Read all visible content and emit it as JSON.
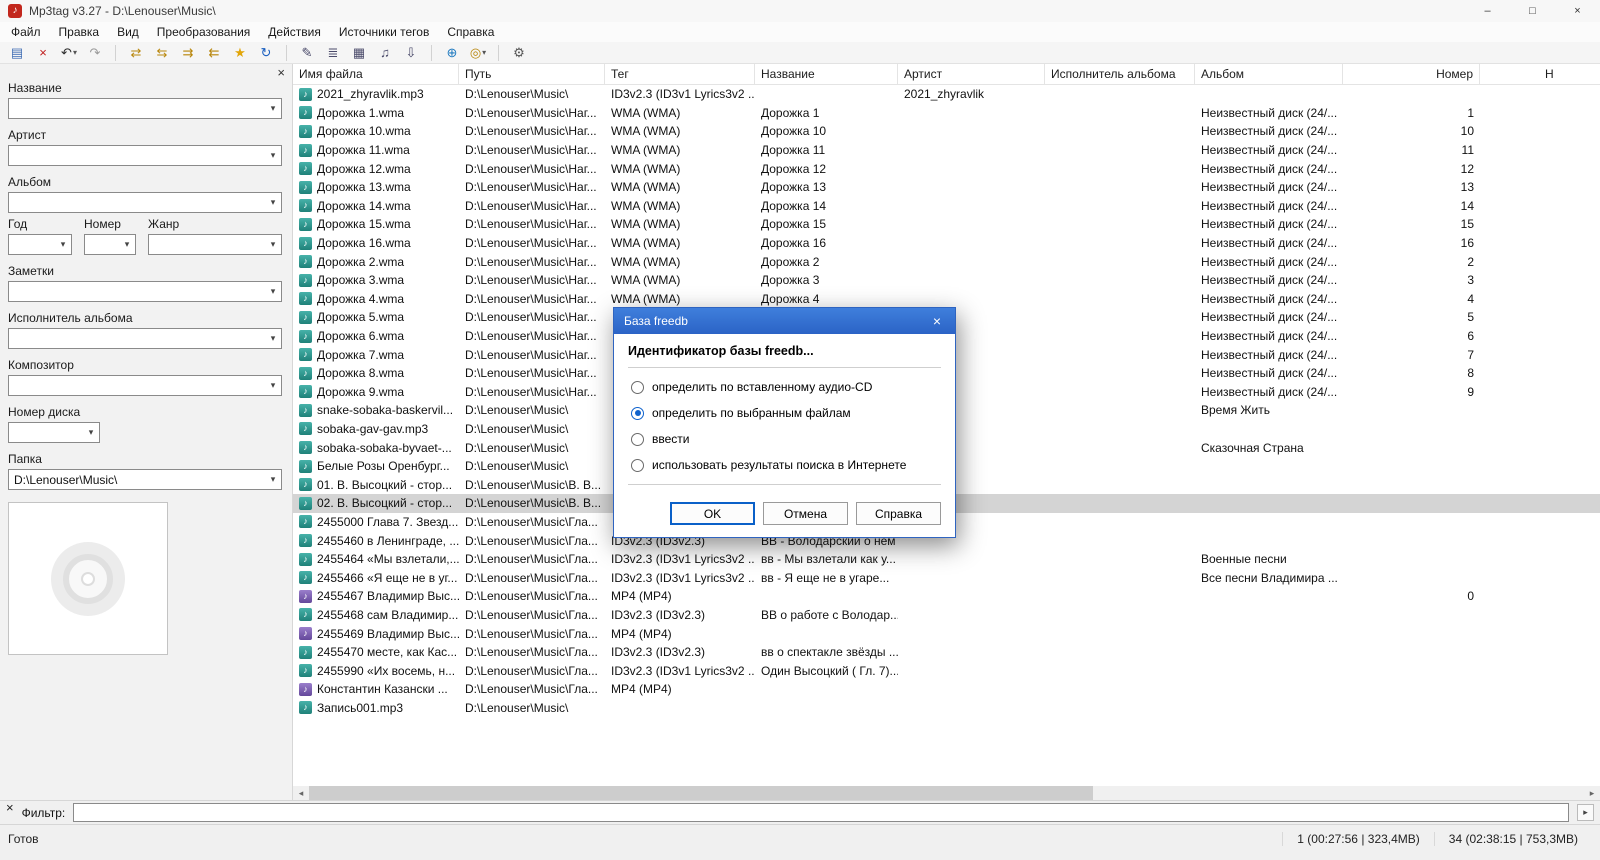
{
  "window": {
    "title": "Mp3tag v3.27 - D:\\Lenouser\\Music\\",
    "minimize": "–",
    "maximize": "□",
    "close": "×",
    "app_glyph": "♪"
  },
  "menu": {
    "items": [
      "Файл",
      "Правка",
      "Вид",
      "Преобразования",
      "Действия",
      "Источники тегов",
      "Справка"
    ]
  },
  "icons": {
    "caret": "▾",
    "scroll_left": "◂",
    "scroll_right": "▸",
    "close": "×",
    "note": "♪"
  },
  "toolbar": {
    "buttons": [
      {
        "name": "save-tag-icon",
        "glyph": "▤",
        "color": "#3f6db4"
      },
      {
        "name": "remove-tag-icon",
        "glyph": "×",
        "color": "#c02020"
      },
      {
        "name": "undo-icon",
        "glyph": "↶",
        "color": "#2c2c2c",
        "caret": true
      },
      {
        "name": "redo-icon",
        "glyph": "↷",
        "color": "#9a9a9a"
      },
      {
        "sep": true
      },
      {
        "name": "convert-tag-filename-icon",
        "glyph": "⇄",
        "color": "#b8860b"
      },
      {
        "name": "convert-filename-tag-icon",
        "glyph": "⇆",
        "color": "#b8860b"
      },
      {
        "name": "convert-filename-filename-icon",
        "glyph": "⇉",
        "color": "#b8860b"
      },
      {
        "name": "convert-text-tag-icon",
        "glyph": "⇇",
        "color": "#b8860b"
      },
      {
        "name": "favorites-star-icon",
        "glyph": "★",
        "color": "#e2a60a"
      },
      {
        "name": "refresh-icon",
        "glyph": "↻",
        "color": "#1a5fc0"
      },
      {
        "sep": true
      },
      {
        "name": "edit-tag-icon",
        "glyph": "✎",
        "color": "#4a4a6a"
      },
      {
        "name": "extended-tags-icon",
        "glyph": "≣",
        "color": "#4a4a6a"
      },
      {
        "name": "cover-art-icon",
        "glyph": "▦",
        "color": "#4a4a6a"
      },
      {
        "name": "playlist-icon",
        "glyph": "♫",
        "color": "#4a4a6a"
      },
      {
        "name": "export-icon",
        "glyph": "⇩",
        "color": "#4a4a6a"
      },
      {
        "sep": true
      },
      {
        "name": "web-sources-icon",
        "glyph": "⊕",
        "color": "#1f7ac0"
      },
      {
        "name": "freedb-icon",
        "glyph": "◎",
        "color": "#b8860b",
        "caret": true
      },
      {
        "sep": true
      },
      {
        "name": "options-icon",
        "glyph": "⚙",
        "color": "#555555"
      }
    ]
  },
  "tag_panel": {
    "close_glyph": "×",
    "labels": {
      "title": "Название",
      "artist": "Артист",
      "album": "Альбом",
      "year": "Год",
      "track": "Номер",
      "genre": "Жанр",
      "comment": "Заметки",
      "albumartist": "Исполнитель альбома",
      "composer": "Композитор",
      "discnumber": "Номер диска",
      "directory": "Папка"
    },
    "directory_value": "D:\\Lenouser\\Music\\"
  },
  "table": {
    "columns": [
      "Имя файла",
      "Путь",
      "Тег",
      "Название",
      "Артист",
      "Исполнитель альбома",
      "Альбом",
      "Номер",
      "Н"
    ],
    "rows": [
      {
        "t": "mp3",
        "name": "2021_zhyravlik.mp3",
        "path": "D:\\Lenouser\\Music\\",
        "tag": "ID3v2.3 (ID3v1 Lyrics3v2 ...",
        "artist": "2021_zhyravlik"
      },
      {
        "t": "wma",
        "name": "Дорожка 1.wma",
        "path": "D:\\Lenouser\\Music\\Наг...",
        "tag": "WMA (WMA)",
        "title": "Дорожка 1",
        "album": "Неизвестный диск (24/...",
        "track": "1"
      },
      {
        "t": "wma",
        "name": "Дорожка 10.wma",
        "path": "D:\\Lenouser\\Music\\Наг...",
        "tag": "WMA (WMA)",
        "title": "Дорожка 10",
        "album": "Неизвестный диск (24/...",
        "track": "10"
      },
      {
        "t": "wma",
        "name": "Дорожка 11.wma",
        "path": "D:\\Lenouser\\Music\\Наг...",
        "tag": "WMA (WMA)",
        "title": "Дорожка 11",
        "album": "Неизвестный диск (24/...",
        "track": "11"
      },
      {
        "t": "wma",
        "name": "Дорожка 12.wma",
        "path": "D:\\Lenouser\\Music\\Наг...",
        "tag": "WMA (WMA)",
        "title": "Дорожка 12",
        "album": "Неизвестный диск (24/...",
        "track": "12"
      },
      {
        "t": "wma",
        "name": "Дорожка 13.wma",
        "path": "D:\\Lenouser\\Music\\Наг...",
        "tag": "WMA (WMA)",
        "title": "Дорожка 13",
        "album": "Неизвестный диск (24/...",
        "track": "13"
      },
      {
        "t": "wma",
        "name": "Дорожка 14.wma",
        "path": "D:\\Lenouser\\Music\\Наг...",
        "tag": "WMA (WMA)",
        "title": "Дорожка 14",
        "album": "Неизвестный диск (24/...",
        "track": "14"
      },
      {
        "t": "wma",
        "name": "Дорожка 15.wma",
        "path": "D:\\Lenouser\\Music\\Наг...",
        "tag": "WMA (WMA)",
        "title": "Дорожка 15",
        "album": "Неизвестный диск (24/...",
        "track": "15"
      },
      {
        "t": "wma",
        "name": "Дорожка 16.wma",
        "path": "D:\\Lenouser\\Music\\Наг...",
        "tag": "WMA (WMA)",
        "title": "Дорожка 16",
        "album": "Неизвестный диск (24/...",
        "track": "16"
      },
      {
        "t": "wma",
        "name": "Дорожка 2.wma",
        "path": "D:\\Lenouser\\Music\\Наг...",
        "tag": "WMA (WMA)",
        "title": "Дорожка 2",
        "album": "Неизвестный диск (24/...",
        "track": "2"
      },
      {
        "t": "wma",
        "name": "Дорожка 3.wma",
        "path": "D:\\Lenouser\\Music\\Наг...",
        "tag": "WMA (WMA)",
        "title": "Дорожка 3",
        "album": "Неизвестный диск (24/...",
        "track": "3"
      },
      {
        "t": "wma",
        "name": "Дорожка 4.wma",
        "path": "D:\\Lenouser\\Music\\Наг...",
        "tag": "WMA (WMA)",
        "title": "Дорожка 4",
        "album": "Неизвестный диск (24/...",
        "track": "4"
      },
      {
        "t": "wma",
        "name": "Дорожка 5.wma",
        "path": "D:\\Lenouser\\Music\\Наг...",
        "album": "Неизвестный диск (24/...",
        "track": "5"
      },
      {
        "t": "wma",
        "name": "Дорожка 6.wma",
        "path": "D:\\Lenouser\\Music\\Наг...",
        "album": "Неизвестный диск (24/...",
        "track": "6"
      },
      {
        "t": "wma",
        "name": "Дорожка 7.wma",
        "path": "D:\\Lenouser\\Music\\Наг...",
        "album": "Неизвестный диск (24/...",
        "track": "7"
      },
      {
        "t": "wma",
        "name": "Дорожка 8.wma",
        "path": "D:\\Lenouser\\Music\\Наг...",
        "album": "Неизвестный диск (24/...",
        "track": "8"
      },
      {
        "t": "wma",
        "name": "Дорожка 9.wma",
        "path": "D:\\Lenouser\\Music\\Наг...",
        "album": "Неизвестный диск (24/...",
        "track": "9"
      },
      {
        "t": "mp3",
        "name": "snake-sobaka-baskervil...",
        "path": "D:\\Lenouser\\Music\\",
        "album": "Время Жить"
      },
      {
        "t": "mp3",
        "name": "sobaka-gav-gav.mp3",
        "path": "D:\\Lenouser\\Music\\"
      },
      {
        "t": "mp3",
        "name": "sobaka-sobaka-byvaet-...",
        "path": "D:\\Lenouser\\Music\\",
        "album": "Сказочная Страна"
      },
      {
        "t": "mp3",
        "name": "Белые Розы Оренбург...",
        "path": "D:\\Lenouser\\Music\\"
      },
      {
        "t": "mp3",
        "name": "01. В. Высоцкий - стор...",
        "path": "D:\\Lenouser\\Music\\В. В..."
      },
      {
        "t": "mp3",
        "name": "02. В. Высоцкий - стор...",
        "path": "D:\\Lenouser\\Music\\В. В...",
        "sel": true
      },
      {
        "t": "mp3",
        "name": "2455000 Глава 7. Звезд...",
        "path": "D:\\Lenouser\\Music\\Гла..."
      },
      {
        "t": "mp3",
        "name": "2455460 в Ленинграде, ...",
        "path": "D:\\Lenouser\\Music\\Гла...",
        "tag": "ID3v2.3 (ID3v2.3)",
        "title": "ВВ - Володарский о нем"
      },
      {
        "t": "mp3",
        "name": "2455464 «Мы взлетали,...",
        "path": "D:\\Lenouser\\Music\\Гла...",
        "tag": "ID3v2.3 (ID3v1 Lyrics3v2 ...",
        "title": "вв - Мы взлетали как у...",
        "album": "Военные песни"
      },
      {
        "t": "mp3",
        "name": "2455466 «Я еще не в уг...",
        "path": "D:\\Lenouser\\Music\\Гла...",
        "tag": "ID3v2.3 (ID3v1 Lyrics3v2 ...",
        "title": "вв - Я еще не в угаре...",
        "album": "Все песни Владимира ..."
      },
      {
        "t": "mp4",
        "name": "2455467 Владимир Выс...",
        "path": "D:\\Lenouser\\Music\\Гла...",
        "tag": "MP4 (MP4)",
        "track": "0"
      },
      {
        "t": "mp3",
        "name": "2455468 сам Владимир...",
        "path": "D:\\Lenouser\\Music\\Гла...",
        "tag": "ID3v2.3 (ID3v2.3)",
        "title": "ВВ о работе с Володар..."
      },
      {
        "t": "mp4",
        "name": "2455469 Владимир Выс...",
        "path": "D:\\Lenouser\\Music\\Гла...",
        "tag": "MP4 (MP4)"
      },
      {
        "t": "mp3",
        "name": "2455470 месте, как Кас...",
        "path": "D:\\Lenouser\\Music\\Гла...",
        "tag": "ID3v2.3 (ID3v2.3)",
        "title": "вв о спектакле звёзды ..."
      },
      {
        "t": "mp3",
        "name": "2455990 «Их восемь, н...",
        "path": "D:\\Lenouser\\Music\\Гла...",
        "tag": "ID3v2.3 (ID3v1 Lyrics3v2 ...",
        "title": "Один Высоцкий ( Гл. 7)..."
      },
      {
        "t": "mp4",
        "name": "Константин Казански ...",
        "path": "D:\\Lenouser\\Music\\Гла...",
        "tag": "MP4 (MP4)"
      },
      {
        "t": "mp3",
        "name": "Запись001.mp3",
        "path": "D:\\Lenouser\\Music\\"
      }
    ]
  },
  "filter": {
    "label": "Фильтр:",
    "value": ""
  },
  "statusbar": {
    "ready": "Готов",
    "selected_info": "1 (00:27:56 | 323,4MB)",
    "total_info": "34 (02:38:15 | 753,3MB)"
  },
  "dialog": {
    "title": "База freedb",
    "close_glyph": "×",
    "header": "Идентификатор базы freedb...",
    "options": [
      {
        "label": "определить по вставленному аудио-CD",
        "checked": false
      },
      {
        "label": "определить по выбранным файлам",
        "checked": true
      },
      {
        "label": "ввести",
        "checked": false
      },
      {
        "label": "использовать результаты поиска в Интернете",
        "checked": false
      }
    ],
    "buttons": [
      "OK",
      "Отмена",
      "Справка"
    ],
    "accent": "#2b63c6"
  }
}
